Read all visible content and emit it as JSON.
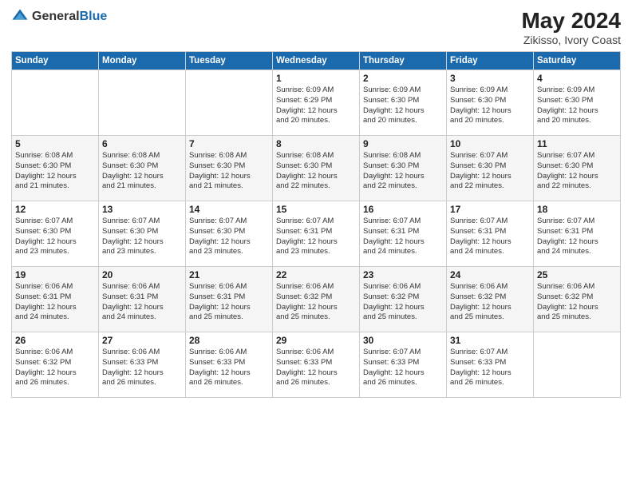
{
  "header": {
    "logo_general": "General",
    "logo_blue": "Blue",
    "title": "May 2024",
    "location": "Zikisso, Ivory Coast"
  },
  "weekdays": [
    "Sunday",
    "Monday",
    "Tuesday",
    "Wednesday",
    "Thursday",
    "Friday",
    "Saturday"
  ],
  "weeks": [
    [
      {
        "day": "",
        "info": ""
      },
      {
        "day": "",
        "info": ""
      },
      {
        "day": "",
        "info": ""
      },
      {
        "day": "1",
        "info": "Sunrise: 6:09 AM\nSunset: 6:29 PM\nDaylight: 12 hours\nand 20 minutes."
      },
      {
        "day": "2",
        "info": "Sunrise: 6:09 AM\nSunset: 6:30 PM\nDaylight: 12 hours\nand 20 minutes."
      },
      {
        "day": "3",
        "info": "Sunrise: 6:09 AM\nSunset: 6:30 PM\nDaylight: 12 hours\nand 20 minutes."
      },
      {
        "day": "4",
        "info": "Sunrise: 6:09 AM\nSunset: 6:30 PM\nDaylight: 12 hours\nand 20 minutes."
      }
    ],
    [
      {
        "day": "5",
        "info": "Sunrise: 6:08 AM\nSunset: 6:30 PM\nDaylight: 12 hours\nand 21 minutes."
      },
      {
        "day": "6",
        "info": "Sunrise: 6:08 AM\nSunset: 6:30 PM\nDaylight: 12 hours\nand 21 minutes."
      },
      {
        "day": "7",
        "info": "Sunrise: 6:08 AM\nSunset: 6:30 PM\nDaylight: 12 hours\nand 21 minutes."
      },
      {
        "day": "8",
        "info": "Sunrise: 6:08 AM\nSunset: 6:30 PM\nDaylight: 12 hours\nand 22 minutes."
      },
      {
        "day": "9",
        "info": "Sunrise: 6:08 AM\nSunset: 6:30 PM\nDaylight: 12 hours\nand 22 minutes."
      },
      {
        "day": "10",
        "info": "Sunrise: 6:07 AM\nSunset: 6:30 PM\nDaylight: 12 hours\nand 22 minutes."
      },
      {
        "day": "11",
        "info": "Sunrise: 6:07 AM\nSunset: 6:30 PM\nDaylight: 12 hours\nand 22 minutes."
      }
    ],
    [
      {
        "day": "12",
        "info": "Sunrise: 6:07 AM\nSunset: 6:30 PM\nDaylight: 12 hours\nand 23 minutes."
      },
      {
        "day": "13",
        "info": "Sunrise: 6:07 AM\nSunset: 6:30 PM\nDaylight: 12 hours\nand 23 minutes."
      },
      {
        "day": "14",
        "info": "Sunrise: 6:07 AM\nSunset: 6:30 PM\nDaylight: 12 hours\nand 23 minutes."
      },
      {
        "day": "15",
        "info": "Sunrise: 6:07 AM\nSunset: 6:31 PM\nDaylight: 12 hours\nand 23 minutes."
      },
      {
        "day": "16",
        "info": "Sunrise: 6:07 AM\nSunset: 6:31 PM\nDaylight: 12 hours\nand 24 minutes."
      },
      {
        "day": "17",
        "info": "Sunrise: 6:07 AM\nSunset: 6:31 PM\nDaylight: 12 hours\nand 24 minutes."
      },
      {
        "day": "18",
        "info": "Sunrise: 6:07 AM\nSunset: 6:31 PM\nDaylight: 12 hours\nand 24 minutes."
      }
    ],
    [
      {
        "day": "19",
        "info": "Sunrise: 6:06 AM\nSunset: 6:31 PM\nDaylight: 12 hours\nand 24 minutes."
      },
      {
        "day": "20",
        "info": "Sunrise: 6:06 AM\nSunset: 6:31 PM\nDaylight: 12 hours\nand 24 minutes."
      },
      {
        "day": "21",
        "info": "Sunrise: 6:06 AM\nSunset: 6:31 PM\nDaylight: 12 hours\nand 25 minutes."
      },
      {
        "day": "22",
        "info": "Sunrise: 6:06 AM\nSunset: 6:32 PM\nDaylight: 12 hours\nand 25 minutes."
      },
      {
        "day": "23",
        "info": "Sunrise: 6:06 AM\nSunset: 6:32 PM\nDaylight: 12 hours\nand 25 minutes."
      },
      {
        "day": "24",
        "info": "Sunrise: 6:06 AM\nSunset: 6:32 PM\nDaylight: 12 hours\nand 25 minutes."
      },
      {
        "day": "25",
        "info": "Sunrise: 6:06 AM\nSunset: 6:32 PM\nDaylight: 12 hours\nand 25 minutes."
      }
    ],
    [
      {
        "day": "26",
        "info": "Sunrise: 6:06 AM\nSunset: 6:32 PM\nDaylight: 12 hours\nand 26 minutes."
      },
      {
        "day": "27",
        "info": "Sunrise: 6:06 AM\nSunset: 6:33 PM\nDaylight: 12 hours\nand 26 minutes."
      },
      {
        "day": "28",
        "info": "Sunrise: 6:06 AM\nSunset: 6:33 PM\nDaylight: 12 hours\nand 26 minutes."
      },
      {
        "day": "29",
        "info": "Sunrise: 6:06 AM\nSunset: 6:33 PM\nDaylight: 12 hours\nand 26 minutes."
      },
      {
        "day": "30",
        "info": "Sunrise: 6:07 AM\nSunset: 6:33 PM\nDaylight: 12 hours\nand 26 minutes."
      },
      {
        "day": "31",
        "info": "Sunrise: 6:07 AM\nSunset: 6:33 PM\nDaylight: 12 hours\nand 26 minutes."
      },
      {
        "day": "",
        "info": ""
      }
    ]
  ]
}
